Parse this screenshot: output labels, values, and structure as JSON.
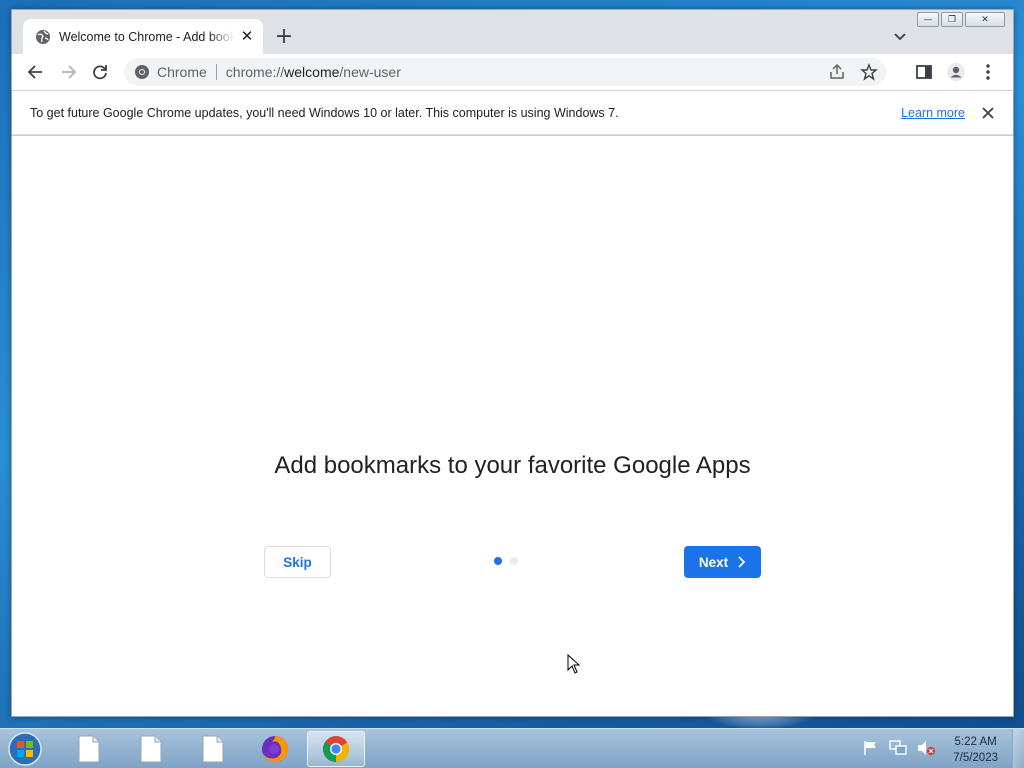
{
  "browser": {
    "tab_title": "Welcome to Chrome - Add bookmarks",
    "omnibox_chip": "Chrome",
    "url_scheme": "chrome://",
    "url_host": "welcome",
    "url_path": "/new-user",
    "window_controls": [
      "minimize",
      "restore",
      "close"
    ]
  },
  "infobar": {
    "message": "To get future Google Chrome updates, you'll need Windows 10 or later. This computer is using Windows 7.",
    "link_label": "Learn more"
  },
  "welcome": {
    "headline": "Add bookmarks to your favorite Google Apps",
    "skip_label": "Skip",
    "next_label": "Next",
    "step_current": 1,
    "step_total": 2
  },
  "taskbar": {
    "items": [
      "file",
      "file",
      "file",
      "firefox",
      "chrome"
    ],
    "active_item": "chrome",
    "tray_icons": [
      "flag-icon",
      "network-icon",
      "volume-muted-icon"
    ],
    "time": "5:22 AM",
    "date": "7/5/2023"
  },
  "colors": {
    "accent": "#1a73e8",
    "tab_strip": "#dee1e6",
    "text": "#202124"
  }
}
